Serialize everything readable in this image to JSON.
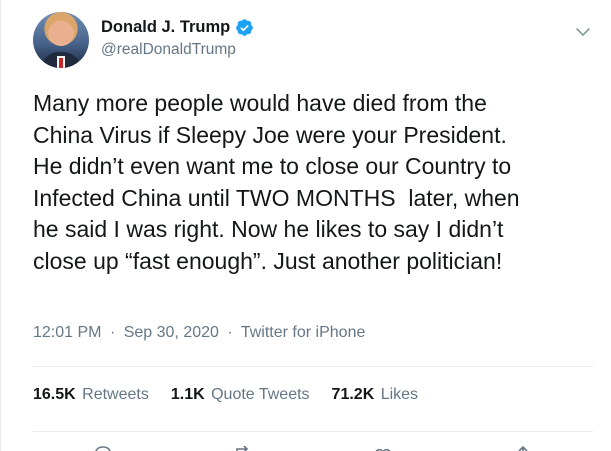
{
  "user": {
    "display_name": "Donald J. Trump",
    "handle": "@realDonaldTrump",
    "verified": true
  },
  "tweet": {
    "text_lines": [
      "Many more people would have died from the",
      "China Virus if Sleepy Joe were your President.",
      "He didn’t even want me to close our Country to",
      "Infected China until TWO MONTHS  later, when",
      "he said I was right. Now he likes to say I didn’t",
      "close up “fast enough”. Just another politician!"
    ],
    "time": "12:01 PM",
    "date": "Sep 30, 2020",
    "source": "Twitter for iPhone",
    "separator": "·"
  },
  "stats": {
    "retweets_count": "16.5K",
    "retweets_label": "Retweets",
    "quotes_count": "1.1K",
    "quotes_label": "Quote Tweets",
    "likes_count": "71.2K",
    "likes_label": "Likes"
  },
  "colors": {
    "text": "#14171a",
    "secondary": "#657786",
    "divider": "#e6ecf0",
    "verified": "#1da1f2"
  },
  "icons": [
    "verified-badge-icon",
    "chevron-down-icon",
    "reply-icon",
    "retweet-icon",
    "like-icon",
    "share-icon"
  ]
}
